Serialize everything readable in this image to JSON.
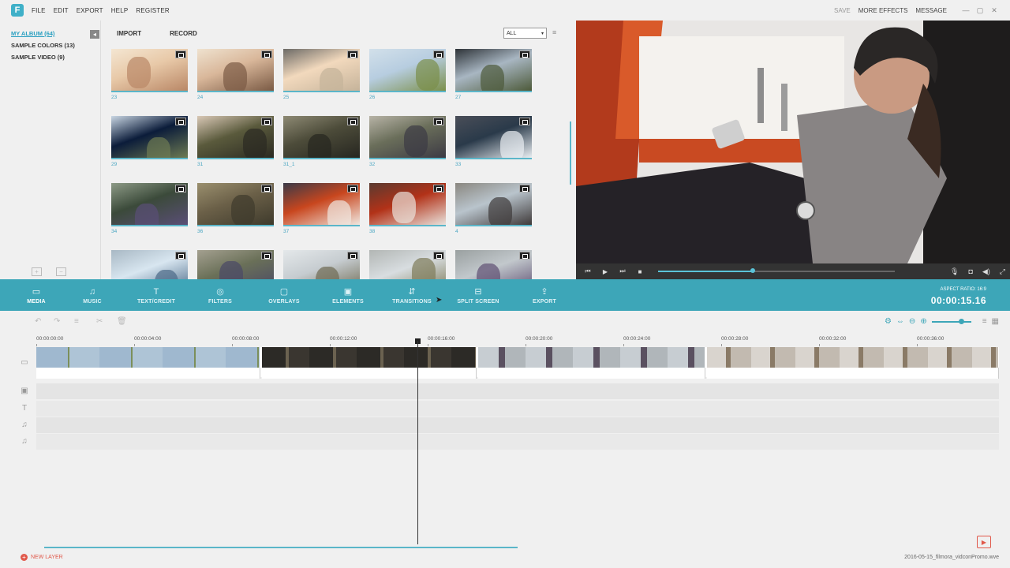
{
  "app": {
    "logo_letter": "F"
  },
  "menu": [
    "FILE",
    "EDIT",
    "EXPORT",
    "HELP",
    "REGISTER"
  ],
  "top_right": {
    "save": "SAVE",
    "more_effects": "MORE EFFECTS",
    "message": "MESSAGE"
  },
  "library": {
    "items": [
      {
        "label": "MY ALBUM (64)",
        "active": true
      },
      {
        "label": "SAMPLE COLORS (13)",
        "active": false
      },
      {
        "label": "SAMPLE VIDEO (9)",
        "active": false
      }
    ]
  },
  "media": {
    "import_label": "IMPORT",
    "record_label": "RECORD",
    "filter_value": "ALL",
    "thumbnails": [
      {
        "label": "23",
        "palette": [
          "#e8c9a8",
          "#b98766",
          "#f4e6d2"
        ]
      },
      {
        "label": "24",
        "palette": [
          "#d9b79a",
          "#7a5a44",
          "#efe2cf"
        ]
      },
      {
        "label": "25",
        "palette": [
          "#f2d9bd",
          "#c5b39a",
          "#6c6a66"
        ]
      },
      {
        "label": "26",
        "palette": [
          "#b7cde0",
          "#7b8f4a",
          "#d2e0ea"
        ]
      },
      {
        "label": "27",
        "palette": [
          "#a8b6c2",
          "#4d5a3a",
          "#2e3338"
        ]
      },
      {
        "label": "29",
        "palette": [
          "#0b1c3a",
          "#6d7a52",
          "#c9d6e3"
        ]
      },
      {
        "label": "31",
        "palette": [
          "#5a5a3c",
          "#2b2a22",
          "#d9c8b6"
        ]
      },
      {
        "label": "31_1",
        "palette": [
          "#4d4c3a",
          "#262620",
          "#8e8a74"
        ]
      },
      {
        "label": "32",
        "palette": [
          "#6a6e5a",
          "#3c3a44",
          "#b7b3a6"
        ]
      },
      {
        "label": "33",
        "palette": [
          "#2a3a4a",
          "#e9eef2",
          "#4a4e58"
        ]
      },
      {
        "label": "34",
        "palette": [
          "#3b4a3a",
          "#5a4e76",
          "#8d9a86"
        ]
      },
      {
        "label": "36",
        "palette": [
          "#6b6048",
          "#3e3a2c",
          "#9a8f6e"
        ]
      },
      {
        "label": "37",
        "palette": [
          "#c8461e",
          "#f0e6de",
          "#3a3a48"
        ]
      },
      {
        "label": "38",
        "palette": [
          "#b23218",
          "#e9e2dc",
          "#5a3a30"
        ]
      },
      {
        "label": "4",
        "palette": [
          "#b9c4cc",
          "#3f3a3a",
          "#8a8780"
        ]
      },
      {
        "label": "",
        "palette": [
          "#d8e6f0",
          "#4c6a88",
          "#a8b8c4"
        ]
      },
      {
        "label": "",
        "palette": [
          "#6a7058",
          "#4a4866",
          "#a4a090"
        ]
      },
      {
        "label": "",
        "palette": [
          "#c6ccd0",
          "#6e6a52",
          "#e4e8ea"
        ]
      },
      {
        "label": "",
        "palette": [
          "#d8dde0",
          "#7d7a58",
          "#b2b6b4"
        ]
      },
      {
        "label": "",
        "palette": [
          "#c2c8cc",
          "#5e4f72",
          "#9aa0a0"
        ]
      }
    ]
  },
  "toolbar": {
    "tools": [
      {
        "label": "MEDIA",
        "icon": "folder-icon",
        "glyph": "▭",
        "active": true
      },
      {
        "label": "MUSIC",
        "icon": "music-icon",
        "glyph": "♫",
        "active": false
      },
      {
        "label": "TEXT/CREDIT",
        "icon": "text-icon",
        "glyph": "T",
        "active": false
      },
      {
        "label": "FILTERS",
        "icon": "filters-icon",
        "glyph": "◎",
        "active": false
      },
      {
        "label": "OVERLAYS",
        "icon": "overlays-icon",
        "glyph": "▢",
        "active": false
      },
      {
        "label": "ELEMENTS",
        "icon": "elements-icon",
        "glyph": "▣",
        "active": false
      },
      {
        "label": "TRANSITIONS",
        "icon": "transitions-icon",
        "glyph": "⇵",
        "active": false
      },
      {
        "label": "SPLIT SCREEN",
        "icon": "split-screen-icon",
        "glyph": "⊟",
        "active": false
      },
      {
        "label": "EXPORT",
        "icon": "export-icon",
        "glyph": "⇪",
        "active": false
      }
    ],
    "aspect_ratio": "ASPECT RATIO: 16:9",
    "timecode": "00:00:15.16"
  },
  "player": {
    "progress": 0.4
  },
  "timeline": {
    "zoom_level": 0.75,
    "ruler": [
      "00:00:00:00",
      "00:00:04:00",
      "00:00:08:00",
      "00:00:12:00",
      "00:00:16:00",
      "00:00:20:00",
      "00:00:24:00",
      "00:00:28:00",
      "00:00:32:00",
      "00:00:36:00"
    ]
  },
  "footer": {
    "new_layer": "NEW LAYER",
    "project_name": "2016-05-15_filmora_vidconPromo.wve"
  },
  "colors": {
    "accent": "#3da6b8",
    "accent_light": "#5bb6c9",
    "danger": "#e0584a"
  }
}
